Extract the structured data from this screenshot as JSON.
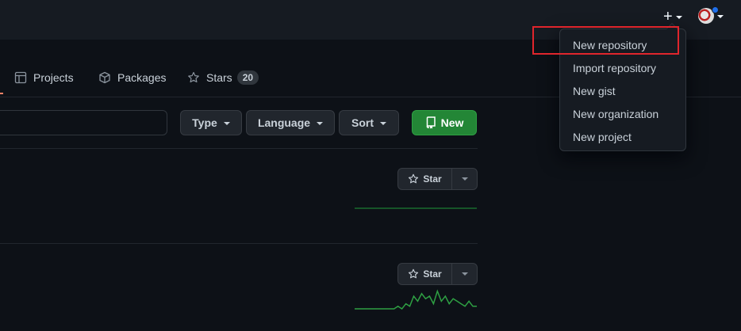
{
  "header": {
    "create_icon": "plus-icon",
    "avatar_icon": "user-avatar"
  },
  "tabs": [
    {
      "label": "Projects",
      "icon": "table-icon"
    },
    {
      "label": "Packages",
      "icon": "package-icon"
    },
    {
      "label": "Stars",
      "icon": "star-icon",
      "count": "20"
    }
  ],
  "filters": {
    "search_value": "",
    "type_label": "Type",
    "language_label": "Language",
    "sort_label": "Sort",
    "new_label": "New"
  },
  "repos": [
    {
      "star_label": "Star",
      "activity": [
        0,
        0,
        0,
        0,
        0,
        0,
        0,
        0,
        0,
        0,
        0,
        0,
        0,
        0,
        0,
        0,
        0,
        0,
        0,
        0,
        0,
        0,
        0,
        0,
        0,
        0,
        0,
        0,
        0,
        0,
        0,
        0
      ]
    },
    {
      "star_label": "Star",
      "activity": [
        0,
        0,
        0,
        0,
        0,
        0,
        0,
        0,
        0,
        0,
        0,
        1,
        0,
        2,
        1,
        5,
        3,
        6,
        4,
        5,
        2,
        7,
        3,
        5,
        2,
        4,
        3,
        2,
        1,
        3,
        1,
        1
      ]
    }
  ],
  "create_menu": {
    "items": [
      "New repository",
      "Import repository",
      "New gist",
      "New organization",
      "New project"
    ],
    "highlighted": "New repository"
  },
  "colors": {
    "background": "#0d1117",
    "header": "#161b22",
    "accent_green": "#238636",
    "spark_green": "#2ea043",
    "highlight_red": "#e0252c",
    "notification_blue": "#1f6feb"
  }
}
